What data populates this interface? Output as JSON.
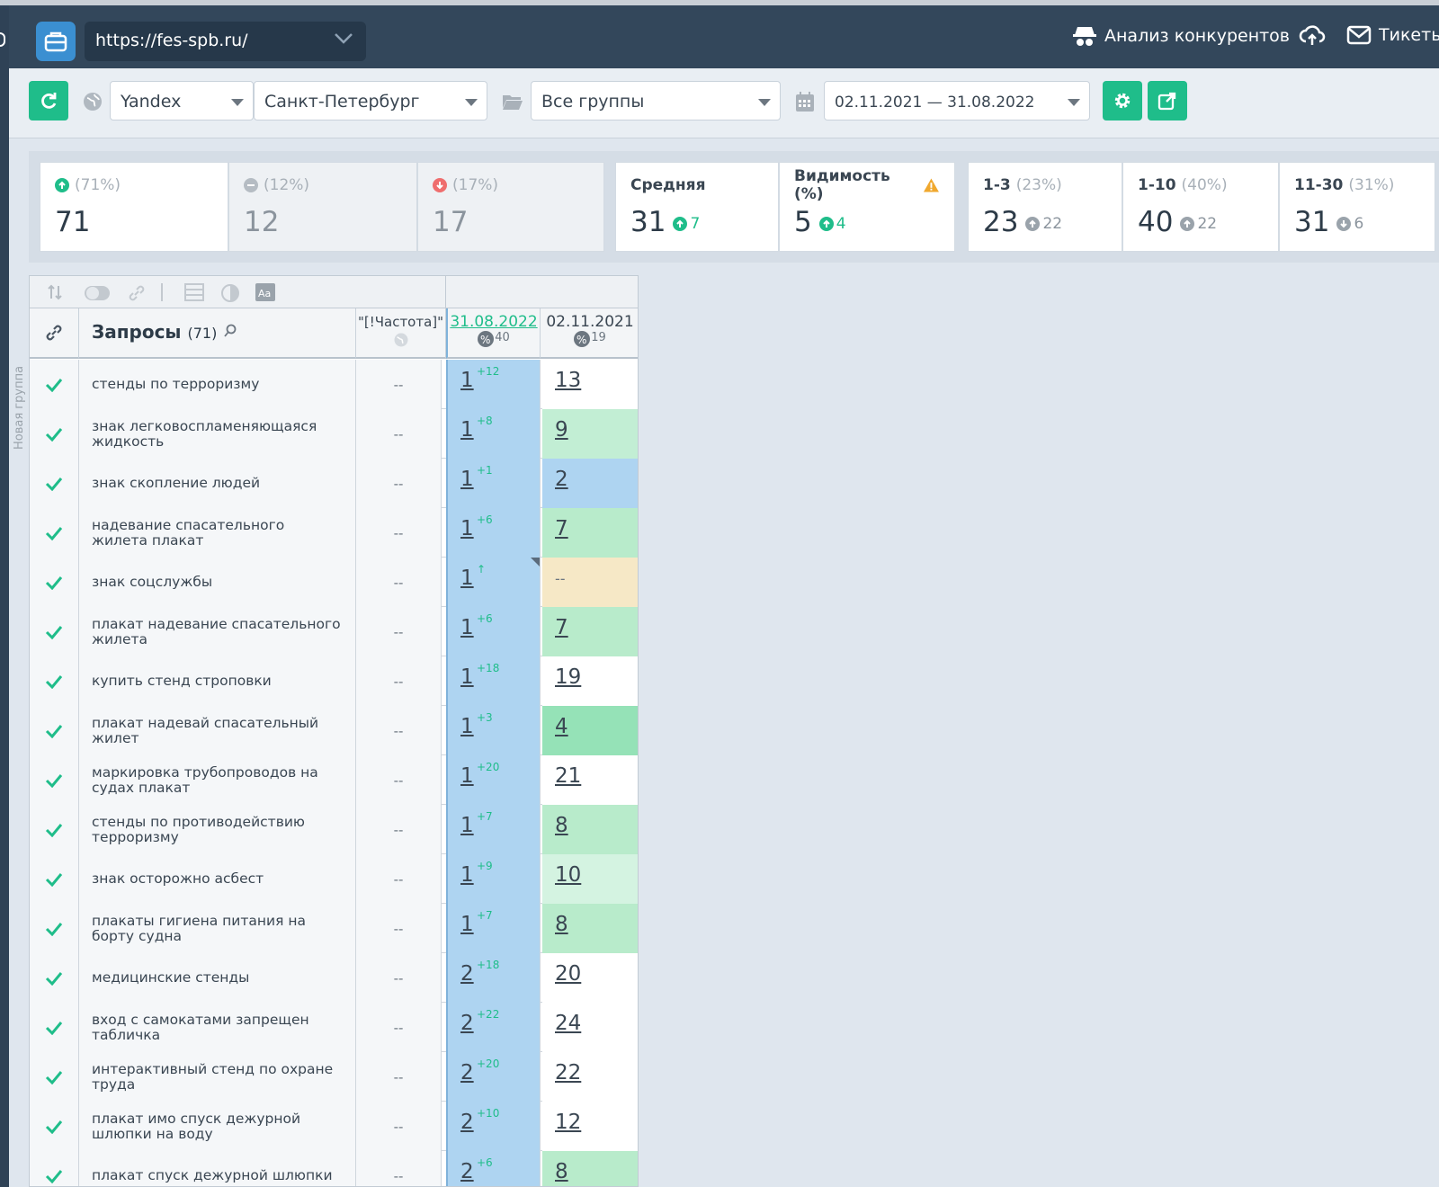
{
  "topbar": {
    "url": "https://fes-spb.ru/",
    "competitors_label": "Анализ конкурентов",
    "tickets_label": "Тикеты"
  },
  "filters": {
    "engine": "Yandex",
    "region": "Санкт-Петербург",
    "groups": "Все группы",
    "date_range": "02.11.2021 — 31.08.2022"
  },
  "stats": {
    "up": {
      "pct": "(71%)",
      "value": "71"
    },
    "same": {
      "pct": "(12%)",
      "value": "12"
    },
    "down": {
      "pct": "(17%)",
      "value": "17"
    },
    "average": {
      "label": "Средняя",
      "value": "31",
      "delta": "7"
    },
    "visibility": {
      "label": "Видимость (%)",
      "value": "5",
      "delta": "4"
    },
    "top3": {
      "label": "1-3",
      "pct": "(23%)",
      "value": "23",
      "delta": "22"
    },
    "top10": {
      "label": "1-10",
      "pct": "(40%)",
      "value": "40",
      "delta": "22"
    },
    "top30": {
      "label": "11-30",
      "pct": "(31%)",
      "value": "31",
      "delta": "6"
    }
  },
  "table": {
    "group_label": "Новая группа",
    "queries_title": "Запросы",
    "queries_count": "(71)",
    "freq_header": "\"[!Частота]\"",
    "date1": "31.08.2022",
    "date1_pct": "40",
    "date2": "02.11.2021",
    "date2_pct": "19",
    "rows": [
      {
        "query": "стенды по терроризму",
        "freq": "--",
        "pos1": "1",
        "delta": "+12",
        "pos2": "13",
        "color": "#ffffff"
      },
      {
        "query": "знак легковоспламеняющаяся жидкость",
        "freq": "--",
        "pos1": "1",
        "delta": "+8",
        "pos2": "9",
        "color": "#c2eed4"
      },
      {
        "query": "знак скопление людей",
        "freq": "--",
        "pos1": "1",
        "delta": "+1",
        "pos2": "2",
        "color": "#aed4f1"
      },
      {
        "query": "надевание спасательного жилета плакат",
        "freq": "--",
        "pos1": "1",
        "delta": "+6",
        "pos2": "7",
        "color": "#b8ebcb"
      },
      {
        "query": "знак соцслужбы",
        "freq": "--",
        "pos1": "1",
        "delta": "↑",
        "pos2": "--",
        "color": "#f6e8c6"
      },
      {
        "query": "плакат надевание спасательного жилета",
        "freq": "--",
        "pos1": "1",
        "delta": "+6",
        "pos2": "7",
        "color": "#b8ebcb"
      },
      {
        "query": "купить стенд строповки",
        "freq": "--",
        "pos1": "1",
        "delta": "+18",
        "pos2": "19",
        "color": "#ffffff"
      },
      {
        "query": "плакат надевай спасательный жилет",
        "freq": "--",
        "pos1": "1",
        "delta": "+3",
        "pos2": "4",
        "color": "#95e2b7"
      },
      {
        "query": "маркировка трубопроводов на судах плакат",
        "freq": "--",
        "pos1": "1",
        "delta": "+20",
        "pos2": "21",
        "color": "#ffffff"
      },
      {
        "query": "стенды по противодействию терроризму",
        "freq": "--",
        "pos1": "1",
        "delta": "+7",
        "pos2": "8",
        "color": "#b8ebcb"
      },
      {
        "query": "знак осторожно асбест",
        "freq": "--",
        "pos1": "1",
        "delta": "+9",
        "pos2": "10",
        "color": "#d4f3e1"
      },
      {
        "query": "плакаты гигиена питания на борту судна",
        "freq": "--",
        "pos1": "1",
        "delta": "+7",
        "pos2": "8",
        "color": "#b8ebcb"
      },
      {
        "query": "медицинские стенды",
        "freq": "--",
        "pos1": "2",
        "delta": "+18",
        "pos2": "20",
        "color": "#ffffff"
      },
      {
        "query": "вход с самокатами запрещен табличка",
        "freq": "--",
        "pos1": "2",
        "delta": "+22",
        "pos2": "24",
        "color": "#ffffff"
      },
      {
        "query": "интерактивный стенд по охране труда",
        "freq": "--",
        "pos1": "2",
        "delta": "+20",
        "pos2": "22",
        "color": "#ffffff"
      },
      {
        "query": "плакат имо спуск дежурной шлюпки на воду",
        "freq": "--",
        "pos1": "2",
        "delta": "+10",
        "pos2": "12",
        "color": "#ffffff"
      },
      {
        "query": "плакат спуск дежурной шлюпки",
        "freq": "--",
        "pos1": "2",
        "delta": "+6",
        "pos2": "8",
        "color": "#b8ebcb"
      }
    ]
  }
}
